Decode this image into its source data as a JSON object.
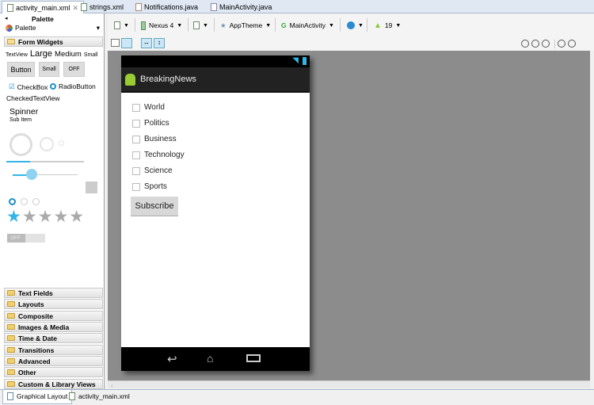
{
  "tabs": [
    "activity_main.xml",
    "strings.xml",
    "Notifications.java",
    "MainActivity.java"
  ],
  "palette": {
    "header": "Palette",
    "selector": "Palette",
    "open_category": "Form Widgets",
    "widgets": {
      "textview": "TextView",
      "large": "Large",
      "medium": "Medium",
      "small": "Small",
      "button": "Button",
      "small_button": "Small",
      "toggle": "OFF",
      "checkbox": "CheckBox",
      "radio": "RadioButton",
      "checked_text": "CheckedTextView",
      "spinner": "Spinner",
      "sub_item": "Sub Item",
      "switch": "OFF"
    },
    "categories": [
      "Text Fields",
      "Layouts",
      "Composite",
      "Images & Media",
      "Time & Date",
      "Transitions",
      "Advanced",
      "Other",
      "Custom & Library Views"
    ]
  },
  "toolbar": {
    "device": "Nexus 4",
    "theme": "AppTheme",
    "activity": "MainActivity",
    "api": "19"
  },
  "phone": {
    "app_title": "BreakingNews",
    "checkboxes": [
      "World",
      "Politics",
      "Business",
      "Technology",
      "Science",
      "Sports"
    ],
    "button": "Subscribe"
  },
  "bottom_tabs": [
    "Graphical Layout",
    "activity_main.xml"
  ]
}
